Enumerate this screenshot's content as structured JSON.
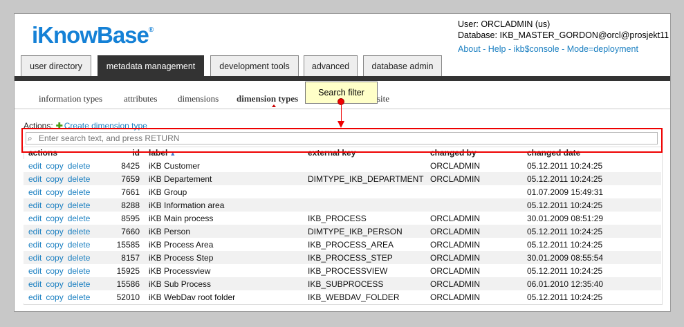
{
  "brand": {
    "name": "iKnowBase",
    "mark": "®"
  },
  "user": {
    "user_line": "User: ORCLADMIN (us)",
    "database_line": "Database: IKB_MASTER_GORDON@orcl@prosjekt11",
    "links": [
      "About",
      "Help",
      "ikb$console",
      "Mode=deployment"
    ],
    "separator": " - "
  },
  "tabs": [
    {
      "label": "user directory",
      "active": false
    },
    {
      "label": "metadata management",
      "active": true
    },
    {
      "label": "development tools",
      "active": false
    },
    {
      "label": "advanced",
      "active": false
    },
    {
      "label": "database admin",
      "active": false
    }
  ],
  "subnav": [
    {
      "label": "information types",
      "active": false
    },
    {
      "label": "attributes",
      "active": false
    },
    {
      "label": "dimensions",
      "active": false
    },
    {
      "label": "dimension types",
      "active": true
    },
    {
      "label": "site",
      "active": false
    }
  ],
  "callout": {
    "label": "Search filter"
  },
  "actions": {
    "label": "Actions:",
    "create_icon": "plus-icon",
    "create_label": "Create dimension type"
  },
  "search": {
    "placeholder": "Enter search text, and press RETURN",
    "icon": "magnifier-icon"
  },
  "table": {
    "columns": [
      "actions",
      "id",
      "label",
      "external key",
      "changed by",
      "changed date"
    ],
    "sort_icon": "sort-ascending-icon",
    "row_actions": [
      "edit",
      "copy",
      "delete"
    ],
    "rows": [
      {
        "id": "8425",
        "label": "iKB Customer",
        "external_key": "",
        "changed_by": "ORCLADMIN",
        "changed_date": "05.12.2011 10:24:25"
      },
      {
        "id": "7659",
        "label": "iKB Departement",
        "external_key": "DIMTYPE_IKB_DEPARTMENT",
        "changed_by": "ORCLADMIN",
        "changed_date": "05.12.2011 10:24:25"
      },
      {
        "id": "7661",
        "label": "iKB Group",
        "external_key": "",
        "changed_by": "",
        "changed_date": "01.07.2009 15:49:31"
      },
      {
        "id": "8288",
        "label": "iKB Information area",
        "external_key": "",
        "changed_by": "",
        "changed_date": "05.12.2011 10:24:25"
      },
      {
        "id": "8595",
        "label": "iKB Main process",
        "external_key": "IKB_PROCESS",
        "changed_by": "ORCLADMIN",
        "changed_date": "30.01.2009 08:51:29"
      },
      {
        "id": "7660",
        "label": "iKB Person",
        "external_key": "DIMTYPE_IKB_PERSON",
        "changed_by": "ORCLADMIN",
        "changed_date": "05.12.2011 10:24:25"
      },
      {
        "id": "15585",
        "label": "iKB Process Area",
        "external_key": "IKB_PROCESS_AREA",
        "changed_by": "ORCLADMIN",
        "changed_date": "05.12.2011 10:24:25"
      },
      {
        "id": "8157",
        "label": "iKB Process Step",
        "external_key": "IKB_PROCESS_STEP",
        "changed_by": "ORCLADMIN",
        "changed_date": "30.01.2009 08:55:54"
      },
      {
        "id": "15925",
        "label": "iKB Processview",
        "external_key": "IKB_PROCESSVIEW",
        "changed_by": "ORCLADMIN",
        "changed_date": "05.12.2011 10:24:25"
      },
      {
        "id": "15586",
        "label": "iKB Sub Process",
        "external_key": "IKB_SUBPROCESS",
        "changed_by": "ORCLADMIN",
        "changed_date": "06.01.2010 12:35:40"
      },
      {
        "id": "52010",
        "label": "iKB WebDav root folder",
        "external_key": "IKB_WEBDAV_FOLDER",
        "changed_by": "ORCLADMIN",
        "changed_date": "05.12.2011 10:24:25"
      }
    ]
  },
  "colors": {
    "accent": "#1a7fc1",
    "highlight": "#ee0000",
    "callout_bg": "#ffffc8",
    "tab_active": "#333333"
  }
}
